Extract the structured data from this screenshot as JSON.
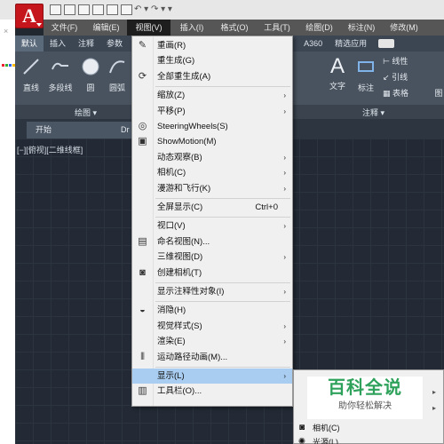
{
  "app": {
    "logo_letter": "A"
  },
  "menubar": {
    "items": [
      "文件(F)",
      "编辑(E)",
      "视图(V)",
      "插入(I)",
      "格式(O)",
      "工具(T)",
      "绘图(D)",
      "标注(N)",
      "修改(M)"
    ],
    "active_index": 2
  },
  "ribbon": {
    "tabs": [
      "默认",
      "插入",
      "注释",
      "参数",
      "A360",
      "精选应用"
    ],
    "active_tab": "默认",
    "tools_left": [
      "直线",
      "多段线",
      "圆",
      "圆弧"
    ],
    "tools_right": [
      "文字",
      "标注"
    ],
    "small_tools": [
      "线性",
      "引线",
      "表格"
    ],
    "panel_draw": "绘图",
    "panel_annotate": "注释",
    "cut_label": "图"
  },
  "doctabs": {
    "start": "开始",
    "drawing_partial": "Dr"
  },
  "viewport_label": "[−][俯视][二维线框]",
  "view_menu": {
    "items": [
      {
        "label": "重画(R)",
        "icon": "pencil-icon"
      },
      {
        "label": "重生成(G)"
      },
      {
        "label": "全部重生成(A)",
        "icon": "regen-all-icon"
      },
      {
        "sep": true
      },
      {
        "label": "缩放(Z)",
        "submenu": true
      },
      {
        "label": "平移(P)",
        "submenu": true
      },
      {
        "label": "SteeringWheels(S)",
        "icon": "steering-wheel-icon"
      },
      {
        "label": "ShowMotion(M)",
        "icon": "showmotion-icon"
      },
      {
        "label": "动态观察(B)",
        "submenu": true
      },
      {
        "label": "相机(C)",
        "submenu": true
      },
      {
        "label": "漫游和飞行(K)",
        "submenu": true
      },
      {
        "sep": true
      },
      {
        "label": "全屏显示(C)",
        "shortcut": "Ctrl+0"
      },
      {
        "sep": true
      },
      {
        "label": "视口(V)",
        "submenu": true
      },
      {
        "label": "命名视图(N)...",
        "icon": "named-view-icon"
      },
      {
        "label": "三维视图(D)",
        "submenu": true
      },
      {
        "label": "创建相机(T)",
        "icon": "camera-icon"
      },
      {
        "sep": true
      },
      {
        "label": "显示注释性对象(I)",
        "submenu": true
      },
      {
        "sep": true
      },
      {
        "label": "消隐(H)",
        "icon": "hide-icon"
      },
      {
        "label": "视觉样式(S)",
        "submenu": true
      },
      {
        "label": "渲染(E)",
        "submenu": true
      },
      {
        "label": "运动路径动画(M)...",
        "icon": "motion-path-icon"
      },
      {
        "sep": true
      },
      {
        "label": "显示(L)",
        "submenu": true,
        "highlighted": true
      },
      {
        "label": "工具栏(O)...",
        "icon": "toolbar-icon"
      }
    ]
  },
  "submenu": {
    "items": [
      {
        "label": "相机(C)",
        "icon": "camera-icon"
      },
      {
        "label": "光源(L)",
        "icon": "light-icon"
      }
    ]
  },
  "watermark": {
    "main": "百科全说",
    "sub": "助你轻松解决"
  },
  "colors": {
    "accent_red": "#c4161c",
    "highlight": "#a9cdf0",
    "canvas": "#232a35",
    "watermark_green": "#2ea15b"
  }
}
